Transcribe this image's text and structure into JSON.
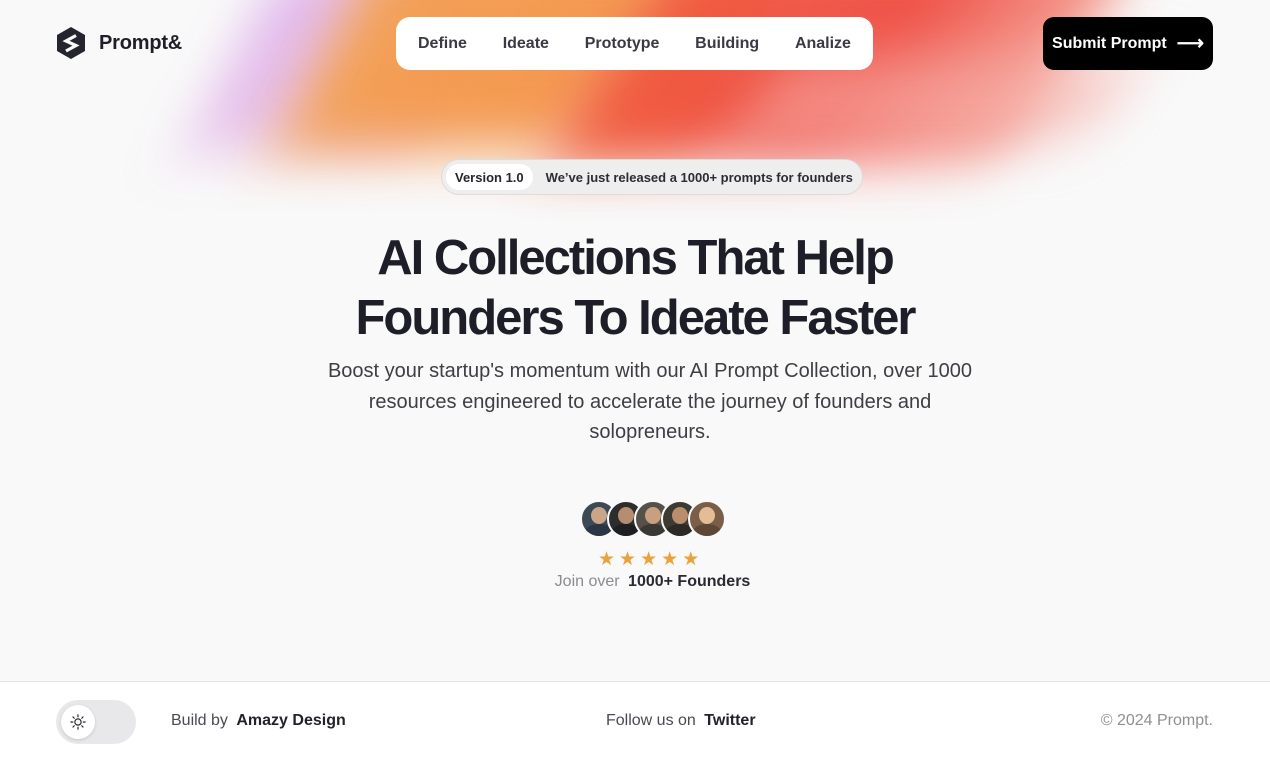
{
  "brand": {
    "name": "Prompt&",
    "logo_icon": "hexagon-s-logo-icon"
  },
  "nav": {
    "items": [
      {
        "label": "Define"
      },
      {
        "label": "Ideate"
      },
      {
        "label": "Prototype"
      },
      {
        "label": "Building"
      },
      {
        "label": "Analize"
      }
    ]
  },
  "header": {
    "cta_label": "Submit Prompt",
    "cta_icon": "arrow-right-icon"
  },
  "announcement": {
    "version": "Version 1.0",
    "text": "We’ve just released a 1000+ prompts for founders"
  },
  "hero": {
    "title_lines": [
      "AI Collections That Help",
      "Founders To Ideate Faster"
    ],
    "subtitle": "Boost your startup's momentum with our AI Prompt Collection, over 1000 resources engineered to accelerate the journey of founders and solopreneurs."
  },
  "social_proof": {
    "rating": 5,
    "rating_max": 5,
    "join_prefix": "Join over",
    "join_highlight": "1000+ Founders"
  },
  "footer": {
    "theme_toggle_icon": "sun-icon",
    "build_prefix": "Build by",
    "build_link": "Amazy Design",
    "follow_prefix": "Follow us on",
    "follow_link": "Twitter",
    "copyright": "© 2024 Prompt."
  },
  "colors": {
    "accent_dark": "#000000",
    "star": "#e8a33d",
    "background": "#f9f9f9"
  }
}
